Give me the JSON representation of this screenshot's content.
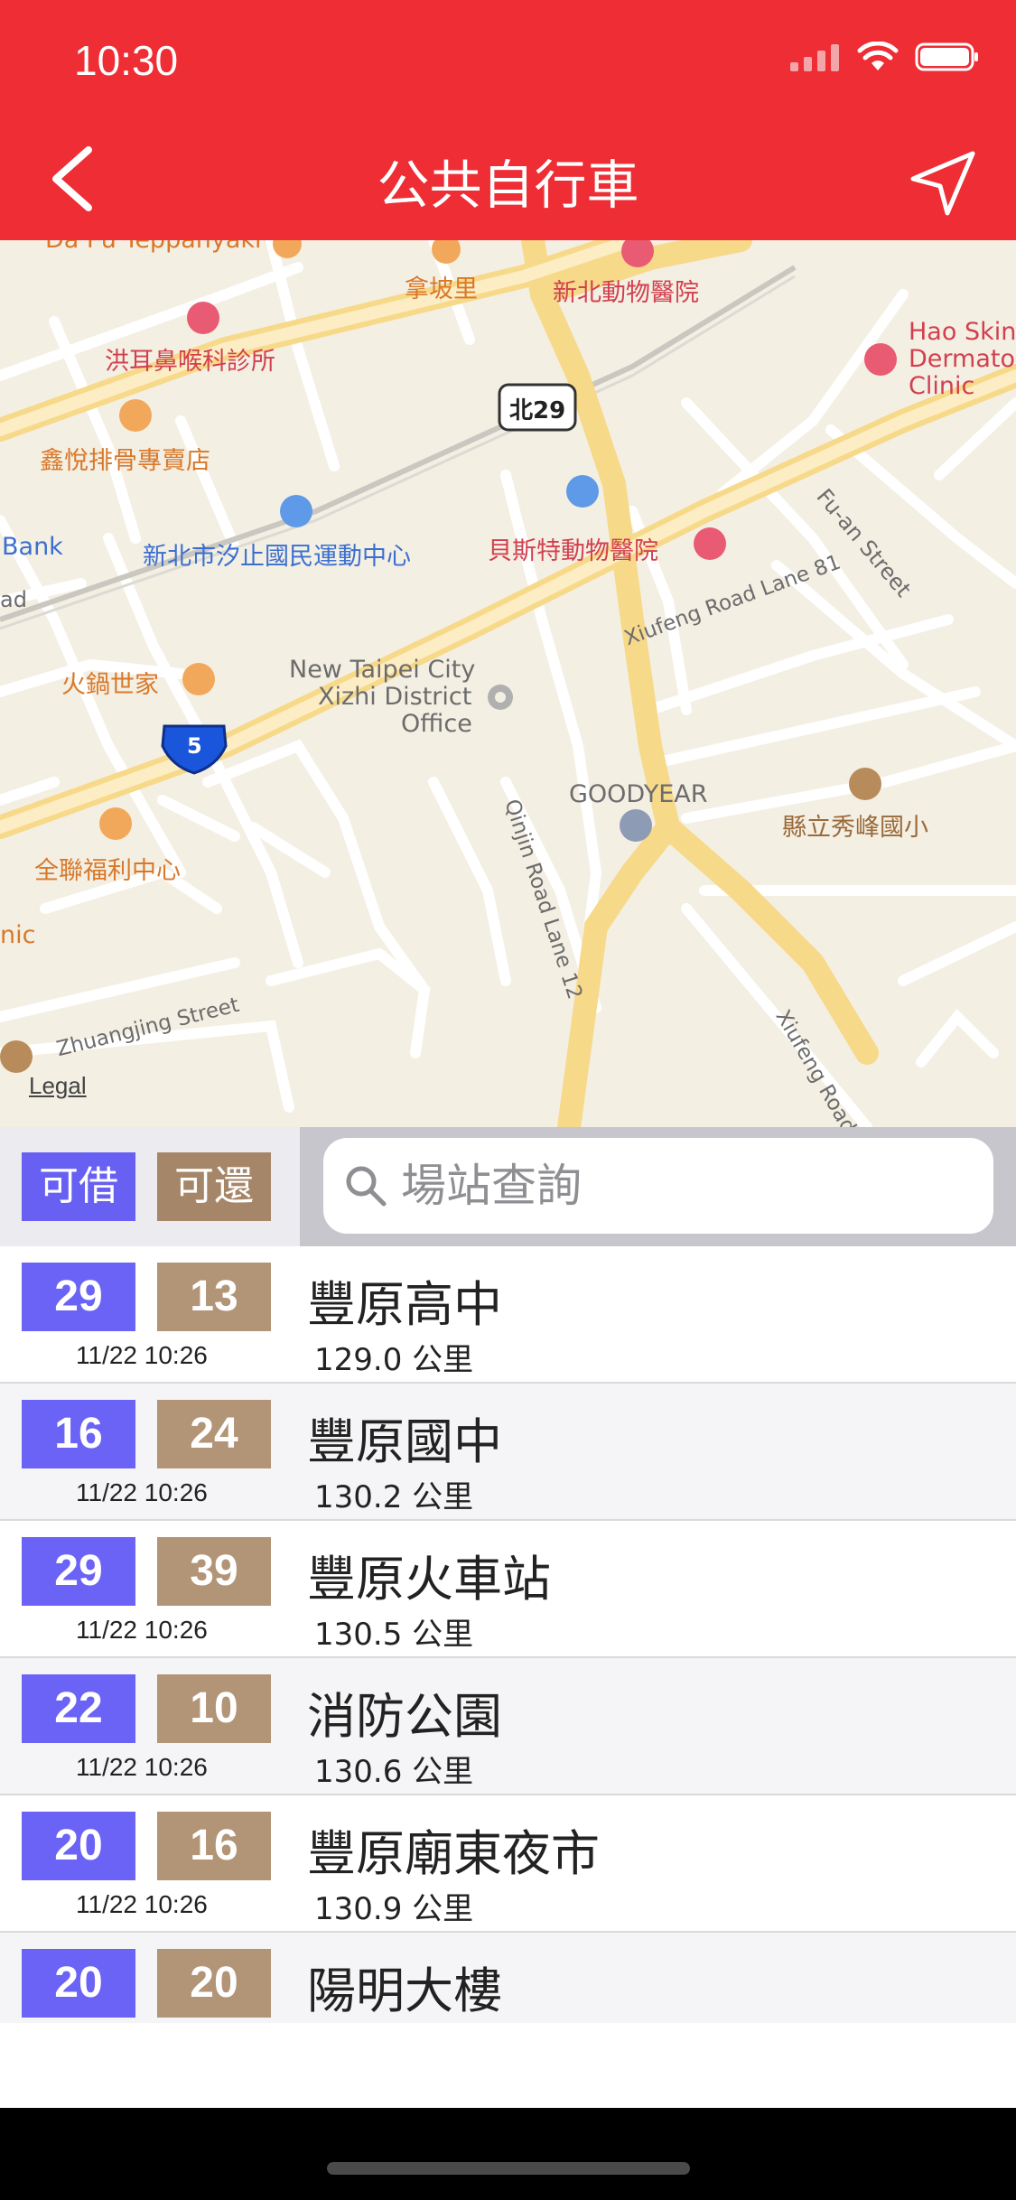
{
  "status_bar": {
    "time": "10:30"
  },
  "header": {
    "title": "公共自行車"
  },
  "map": {
    "labels": {
      "dapu": "Da Pu Teppanyaki",
      "napo": "拿坡里",
      "zoo_hospital": "新北動物醫院",
      "ent_clinic": "洪耳鼻喉科診所",
      "hao_skin_1": "Hao Skin",
      "hao_skin_2": "Dermato",
      "hao_skin_3": "Clinic",
      "bei29": "北29",
      "bone_shop": "鑫悅排骨專賣店",
      "fuan": "Fu-an Street",
      "bank": "Bank",
      "sports_center": "新北市汐止國民運動中心",
      "pet_hospital": "貝斯特動物醫院",
      "ad": "ad",
      "xiufeng81": "Xiufeng Road Lane 81",
      "hotpot": "火鍋世家",
      "ntpc_1": "New Taipei City",
      "ntpc_2": "Xizhi District",
      "ntpc_3": "Office",
      "route5": "5",
      "goodyear": "GOODYEAR",
      "school": "縣立秀峰國小",
      "qinjin": "Qinjin Road Lane 12",
      "pxmart": "全聯福利中心",
      "nic": "nic",
      "zhuangjing": "Zhuangjing Street",
      "xiufeng_road": "Xiufeng Road",
      "legal": "Legal"
    }
  },
  "toolbar": {
    "borrow_label": "可借",
    "return_label": "可還",
    "search_placeholder": "場站查詢"
  },
  "stations": [
    {
      "borrow": "29",
      "return": "13",
      "time": "11/22 10:26",
      "name": "豐原高中",
      "distance": "129.0 公里"
    },
    {
      "borrow": "16",
      "return": "24",
      "time": "11/22 10:26",
      "name": "豐原國中",
      "distance": "130.2 公里"
    },
    {
      "borrow": "29",
      "return": "39",
      "time": "11/22 10:26",
      "name": "豐原火車站",
      "distance": "130.5 公里"
    },
    {
      "borrow": "22",
      "return": "10",
      "time": "11/22 10:26",
      "name": "消防公園",
      "distance": "130.6 公里"
    },
    {
      "borrow": "20",
      "return": "16",
      "time": "11/22 10:26",
      "name": "豐原廟東夜市",
      "distance": "130.9 公里"
    },
    {
      "borrow": "20",
      "return": "20",
      "time": "",
      "name": "陽明大樓",
      "distance": ""
    }
  ],
  "colors": {
    "header": "#ee2d34",
    "borrow": "#6a63f6",
    "return": "#b29477"
  }
}
